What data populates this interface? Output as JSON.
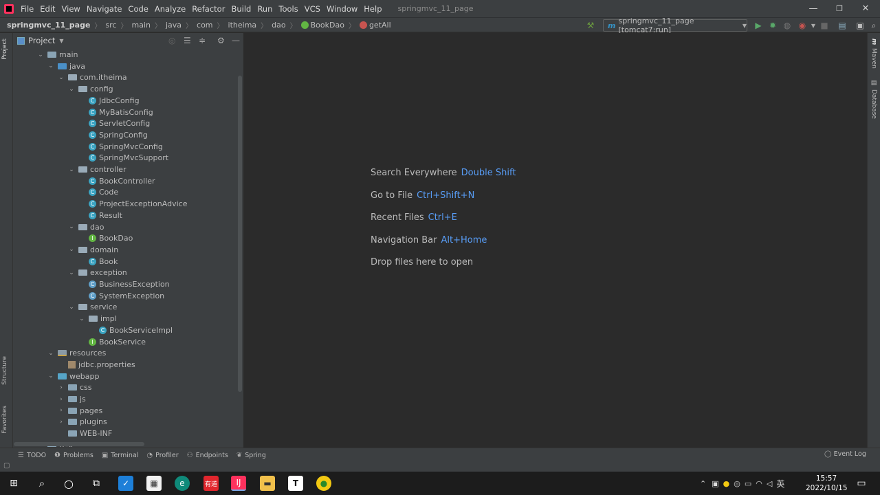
{
  "menubar": {
    "items": [
      "File",
      "Edit",
      "View",
      "Navigate",
      "Code",
      "Analyze",
      "Refactor",
      "Build",
      "Run",
      "Tools",
      "VCS",
      "Window",
      "Help"
    ],
    "project_title": "springmvc_11_page",
    "min": "—",
    "max": "❐",
    "close": "✕"
  },
  "breadcrumbs": {
    "project": "springmvc_11_page",
    "items": [
      "src",
      "main",
      "java",
      "com",
      "itheima",
      "dao",
      "BookDao",
      "getAll"
    ]
  },
  "run_config": {
    "label": "springmvc_11_page [tomcat7:run]",
    "icon_letter": "m"
  },
  "left_tabs": {
    "project": "Project",
    "structure": "Structure",
    "favorites": "Favorites"
  },
  "right_tabs": {
    "maven": "Maven",
    "database": "Database"
  },
  "project_panel": {
    "title": "Project"
  },
  "tree": [
    {
      "label": "main",
      "depth": 0,
      "kind": "folder",
      "open": true
    },
    {
      "label": "java",
      "depth": 1,
      "kind": "src",
      "open": true
    },
    {
      "label": "com.itheima",
      "depth": 2,
      "kind": "pkg",
      "open": true
    },
    {
      "label": "config",
      "depth": 3,
      "kind": "pkg",
      "open": true
    },
    {
      "label": "JdbcConfig",
      "depth": 4,
      "kind": "class"
    },
    {
      "label": "MyBatisConfig",
      "depth": 4,
      "kind": "class"
    },
    {
      "label": "ServletConfig",
      "depth": 4,
      "kind": "class"
    },
    {
      "label": "SpringConfig",
      "depth": 4,
      "kind": "class"
    },
    {
      "label": "SpringMvcConfig",
      "depth": 4,
      "kind": "class"
    },
    {
      "label": "SpringMvcSupport",
      "depth": 4,
      "kind": "class"
    },
    {
      "label": "controller",
      "depth": 3,
      "kind": "pkg",
      "open": true
    },
    {
      "label": "BookController",
      "depth": 4,
      "kind": "class"
    },
    {
      "label": "Code",
      "depth": 4,
      "kind": "class"
    },
    {
      "label": "ProjectExceptionAdvice",
      "depth": 4,
      "kind": "class"
    },
    {
      "label": "Result",
      "depth": 4,
      "kind": "class"
    },
    {
      "label": "dao",
      "depth": 3,
      "kind": "pkg",
      "open": true
    },
    {
      "label": "BookDao",
      "depth": 4,
      "kind": "interface"
    },
    {
      "label": "domain",
      "depth": 3,
      "kind": "pkg",
      "open": true
    },
    {
      "label": "Book",
      "depth": 4,
      "kind": "class"
    },
    {
      "label": "exception",
      "depth": 3,
      "kind": "pkg",
      "open": true
    },
    {
      "label": "BusinessException",
      "depth": 4,
      "kind": "exception"
    },
    {
      "label": "SystemException",
      "depth": 4,
      "kind": "exception"
    },
    {
      "label": "service",
      "depth": 3,
      "kind": "pkg",
      "open": true
    },
    {
      "label": "impl",
      "depth": 4,
      "kind": "pkg",
      "open": true
    },
    {
      "label": "BookServiceImpl",
      "depth": 5,
      "kind": "class"
    },
    {
      "label": "BookService",
      "depth": 4,
      "kind": "interface"
    },
    {
      "label": "resources",
      "depth": 1,
      "kind": "res",
      "open": true
    },
    {
      "label": "jdbc.properties",
      "depth": 2,
      "kind": "prop"
    },
    {
      "label": "webapp",
      "depth": 1,
      "kind": "web",
      "open": true
    },
    {
      "label": "css",
      "depth": 2,
      "kind": "folder",
      "open": false
    },
    {
      "label": "js",
      "depth": 2,
      "kind": "folder",
      "open": false
    },
    {
      "label": "pages",
      "depth": 2,
      "kind": "folder",
      "open": false
    },
    {
      "label": "plugins",
      "depth": 2,
      "kind": "folder",
      "open": false
    },
    {
      "label": "WEB-INF",
      "depth": 2,
      "kind": "folder",
      "leaf": true
    },
    {
      "label": "test",
      "depth": 0,
      "kind": "folder",
      "open": false
    }
  ],
  "editor_hints": [
    {
      "text": "Search Everywhere",
      "key": "Double Shift"
    },
    {
      "text": "Go to File",
      "key": "Ctrl+Shift+N"
    },
    {
      "text": "Recent Files",
      "key": "Ctrl+E"
    },
    {
      "text": "Navigation Bar",
      "key": "Alt+Home"
    },
    {
      "text": "Drop files here to open",
      "key": ""
    }
  ],
  "tool_windows": [
    {
      "label": "TODO",
      "icon": "list-icon"
    },
    {
      "label": "Problems",
      "icon": "problems-icon"
    },
    {
      "label": "Terminal",
      "icon": "terminal-icon"
    },
    {
      "label": "Profiler",
      "icon": "profiler-icon"
    },
    {
      "label": "Endpoints",
      "icon": "endpoints-icon"
    },
    {
      "label": "Spring",
      "icon": "spring-icon"
    }
  ],
  "event_log": "Event Log",
  "taskbar": {
    "time": "15:57",
    "date": "2022/10/15",
    "ime": "英",
    "notes_app": "有道"
  },
  "colors": {
    "accent_key": "#589df6",
    "editor_bg": "#2b2b2b",
    "panel_bg": "#3c3f41"
  }
}
